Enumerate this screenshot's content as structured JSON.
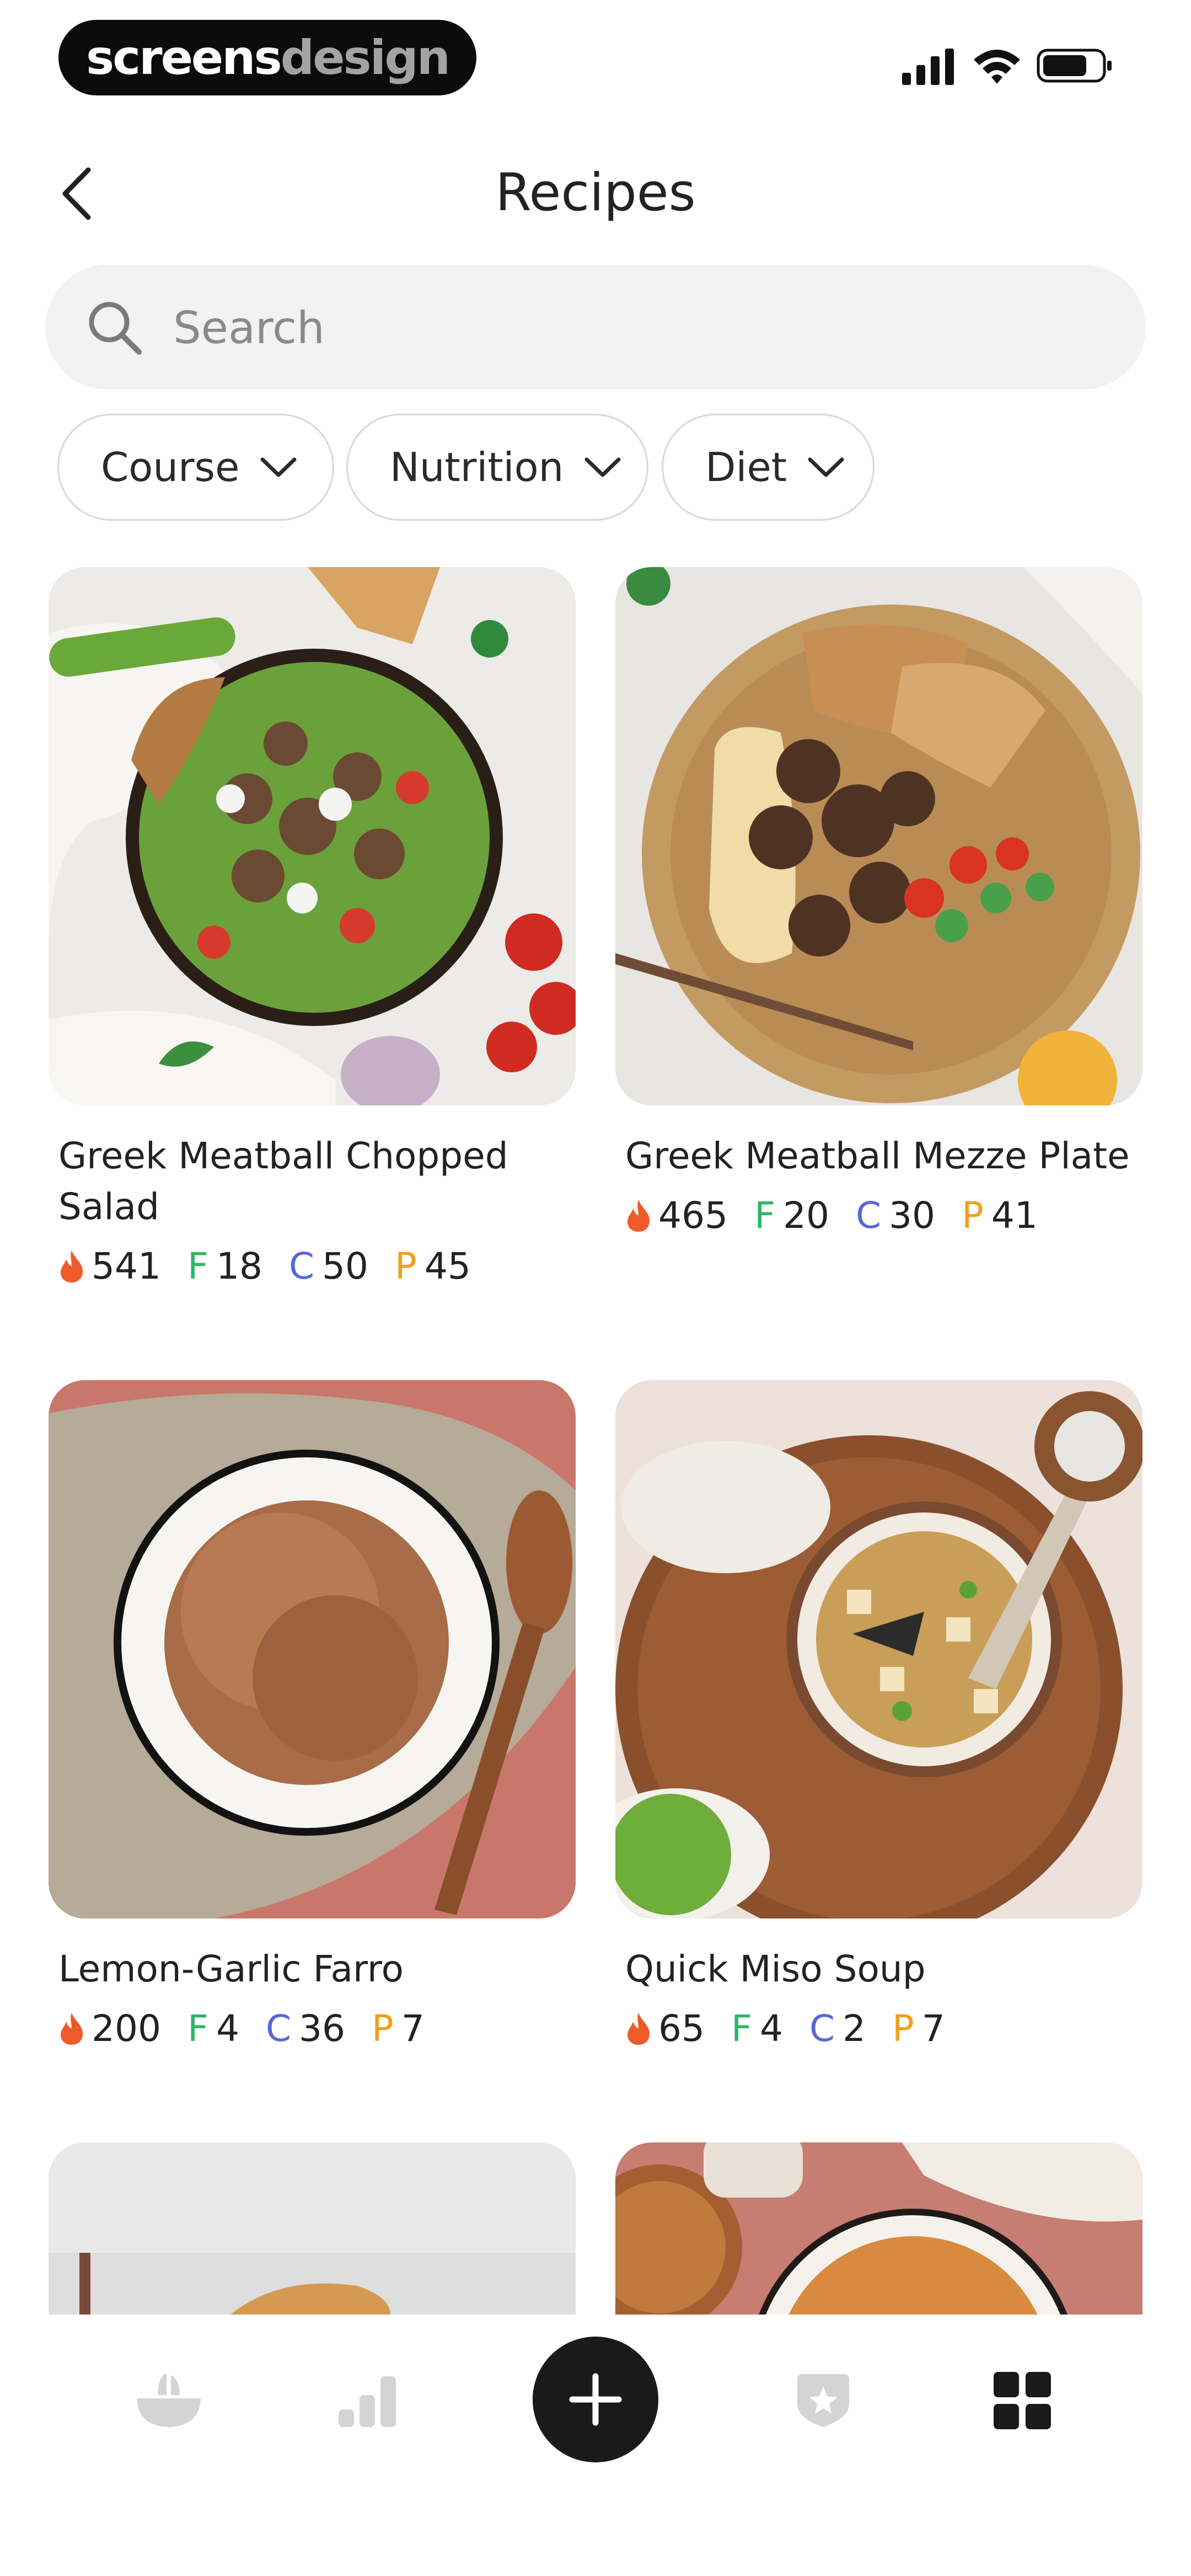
{
  "status_bar": {
    "brand_left": "screens",
    "brand_right": "design"
  },
  "header": {
    "title": "Recipes"
  },
  "search": {
    "placeholder": "Search",
    "value": ""
  },
  "filters": [
    {
      "label": "Course"
    },
    {
      "label": "Nutrition"
    },
    {
      "label": "Diet"
    }
  ],
  "recipes": [
    {
      "name": "Greek Meatball Chopped Salad",
      "calories": "541",
      "fat": "18",
      "carbs": "50",
      "protein": "45"
    },
    {
      "name": "Greek Meatball Mezze Plate",
      "calories": "465",
      "fat": "20",
      "carbs": "30",
      "protein": "41"
    },
    {
      "name": "Lemon-Garlic Farro",
      "calories": "200",
      "fat": "4",
      "carbs": "36",
      "protein": "7"
    },
    {
      "name": "Quick Miso Soup",
      "calories": "65",
      "fat": "4",
      "carbs": "2",
      "protein": "7"
    }
  ],
  "macro_letters": {
    "fat": "F",
    "carbs": "C",
    "protein": "P"
  },
  "bottom_nav": {
    "items": [
      "bowl-icon",
      "stats-icon",
      "add-icon",
      "badge-icon",
      "grid-icon"
    ],
    "active": "grid-icon"
  },
  "colors": {
    "fat": "#2fb567",
    "carbs": "#5867d8",
    "protein": "#f0a01c",
    "flame": "#ef5a2a"
  }
}
